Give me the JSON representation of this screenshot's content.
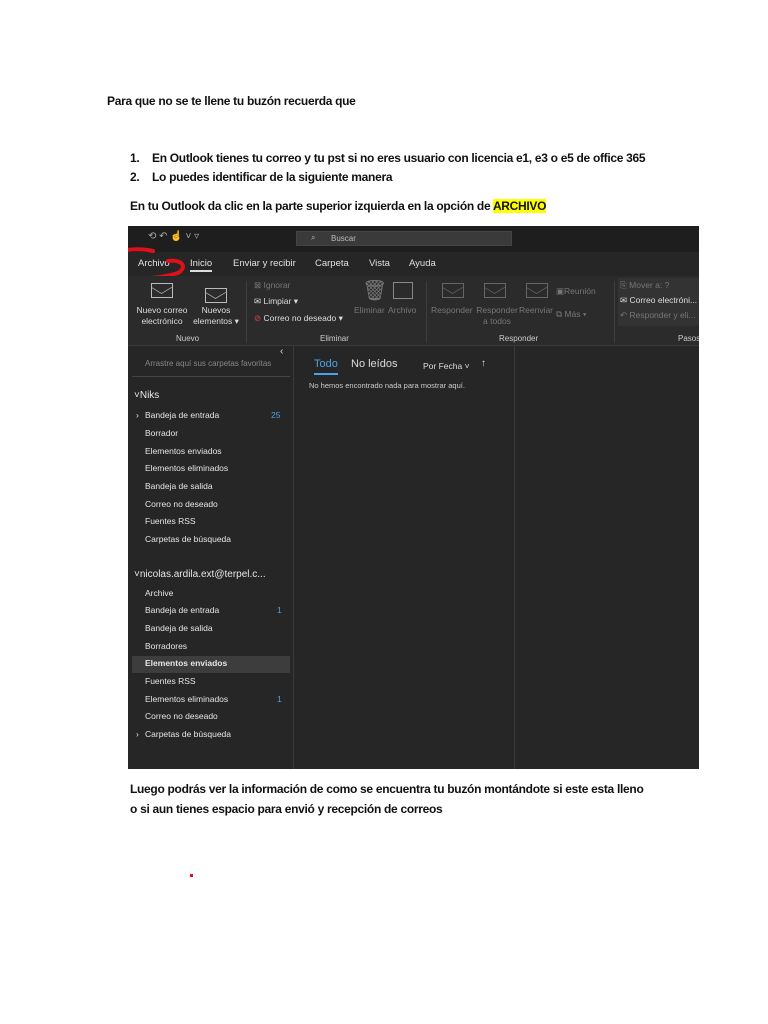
{
  "document": {
    "intro": "Para que no se te llene tu buzón recuerda que",
    "list": [
      {
        "num": "1.",
        "text": "En Outlook tienes tu correo y tu pst si no eres usuario con licencia e1, e3 o e5 de office 365"
      },
      {
        "num": "2.",
        "text": "Lo puedes identificar de la siguiente manera"
      }
    ],
    "instruction": "En tu Outlook da clic en la parte superior izquierda  en la opción de ",
    "instruction_highlight": "ARCHIVO",
    "after_line1": "Luego podrás ver la información de como se encuentra tu buzón montándote si este esta lleno",
    "after_line2": "o si aun tienes espacio para envió y recepción de correos"
  },
  "outlook": {
    "search_placeholder": "Buscar",
    "tabs": [
      "Archivo",
      "Inicio",
      "Enviar y recibir",
      "Carpeta",
      "Vista",
      "Ayuda"
    ],
    "ribbon": {
      "nuevo_correo": "Nuevo correo\nelectrónico",
      "nuevos_elementos": "Nuevos\nelementos ▾",
      "ignorar": "Ignorar",
      "limpiar": "Limpiar ▾",
      "correo_no_deseado": "Correo no deseado ▾",
      "eliminar": "Eliminar",
      "archivo": "Archivo",
      "responder": "Responder",
      "responder_todos": "Responder\na todos",
      "reenviar": "Reenviar",
      "reunion": "Reunión",
      "mas": "Más ▾",
      "mover": "Mover a: ?",
      "correo_electronico": "Correo electróni...",
      "responder_eliminar": "Responder y eli...",
      "groups": [
        "Nuevo",
        "Eliminar",
        "Responder",
        "Pasos"
      ]
    },
    "favorites_hint": "Arrastre aquí sus carpetas favoritas",
    "accounts": [
      {
        "name": "Niks",
        "folders": [
          {
            "label": "Bandeja de entrada",
            "count": "25",
            "expandable": true
          },
          {
            "label": "Borrador"
          },
          {
            "label": "Elementos enviados"
          },
          {
            "label": "Elementos eliminados"
          },
          {
            "label": "Bandeja de salida"
          },
          {
            "label": "Correo no deseado"
          },
          {
            "label": "Fuentes RSS"
          },
          {
            "label": "Carpetas de búsqueda"
          }
        ]
      },
      {
        "name": "nicolas.ardila.ext@terpel.c...",
        "folders": [
          {
            "label": "Archive"
          },
          {
            "label": "Bandeja de entrada",
            "count": "1"
          },
          {
            "label": "Bandeja de salida"
          },
          {
            "label": "Borradores"
          },
          {
            "label": "Elementos enviados",
            "selected": true
          },
          {
            "label": "Fuentes RSS"
          },
          {
            "label": "Elementos eliminados",
            "count": "1"
          },
          {
            "label": "Correo no deseado"
          },
          {
            "label": "Carpetas de búsqueda",
            "expandable": true
          }
        ]
      }
    ],
    "list_tabs": [
      "Todo",
      "No leídos"
    ],
    "sort": "Por Fecha",
    "empty_message": "No hemos encontrado nada para mostrar aquí."
  },
  "colors": {
    "accent": "#4aa3e8",
    "highlight": "#ffff00",
    "annotation": "#e0101a"
  }
}
